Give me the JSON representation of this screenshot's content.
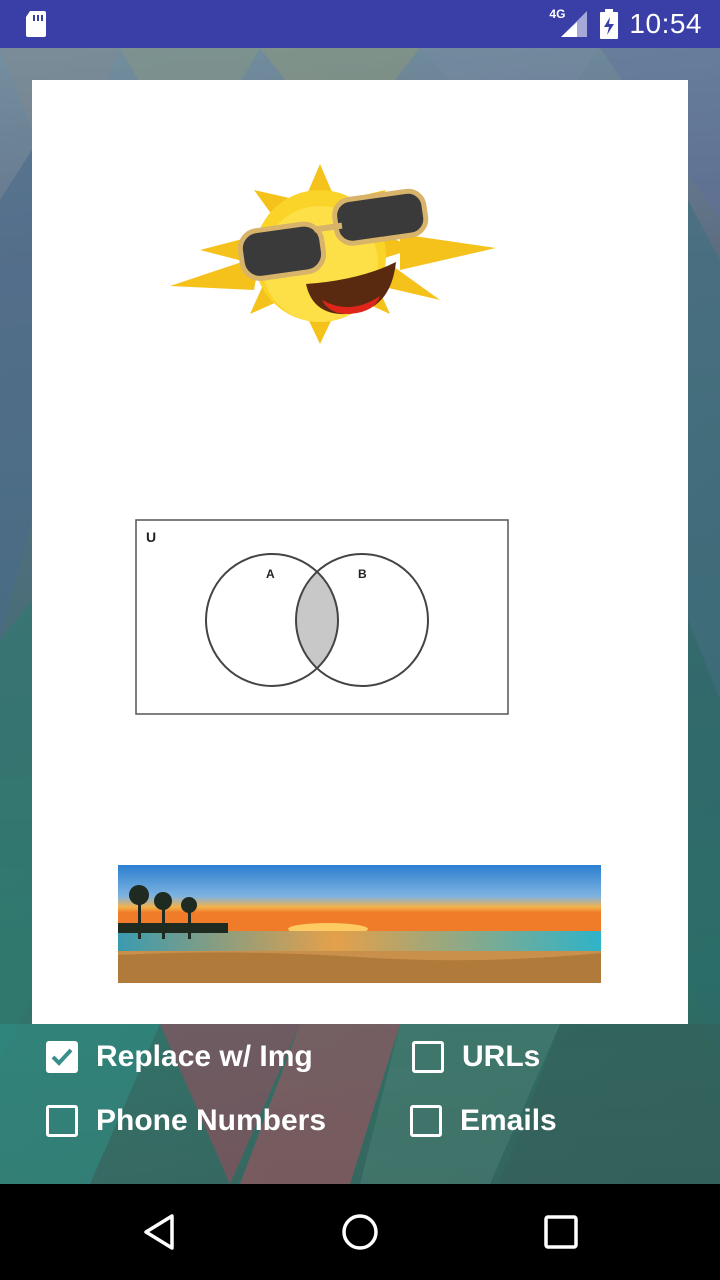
{
  "status_bar": {
    "network": "4G",
    "time": "10:54",
    "icons": [
      "sd-card-icon",
      "signal-icon",
      "battery-charging-icon"
    ]
  },
  "content": {
    "images": [
      "sun-with-sunglasses",
      "venn-diagram",
      "beach-sunset"
    ],
    "venn": {
      "universe_label": "U",
      "set_a_label": "A",
      "set_b_label": "B"
    }
  },
  "options": [
    {
      "label": "Replace w/ Img",
      "checked": true
    },
    {
      "label": "URLs",
      "checked": false
    },
    {
      "label": "Phone Numbers",
      "checked": false
    },
    {
      "label": "Emails",
      "checked": false
    }
  ],
  "nav": {
    "icons": [
      "back-icon",
      "home-icon",
      "recents-icon"
    ]
  },
  "colors": {
    "status_bar": "#3a3fa8",
    "card": "#ffffff",
    "checkbox_accent": "#3a8f8a",
    "nav_bar": "#000000"
  }
}
